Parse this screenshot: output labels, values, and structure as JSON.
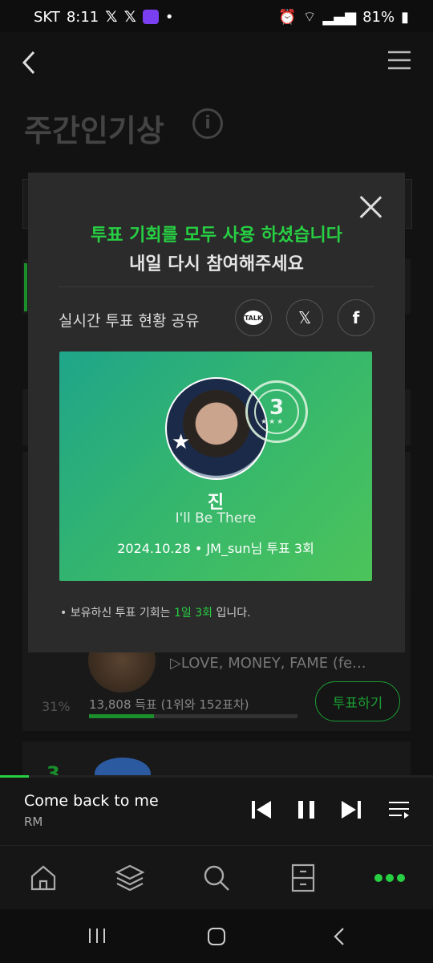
{
  "status_bar": {
    "carrier": "SKT",
    "time": "8:11",
    "battery": "81%"
  },
  "page": {
    "title": "주간인기상"
  },
  "modal": {
    "message_primary": "투표 기회를 모두 사용 하셨습니다",
    "message_secondary": "내일 다시 참여해주세요",
    "share_label": "실시간 투표 현황 공유",
    "share_buttons": [
      "kakaotalk-icon",
      "x-icon",
      "facebook-icon"
    ],
    "talk_label": "TALK",
    "card": {
      "stamp_number": "3",
      "artist": "진",
      "song": "I'll Be There",
      "meta": "2024.10.28  •  JM_sun님 투표 3회"
    },
    "note_prefix": "• 보유하신 투표 기회는 ",
    "note_highlight": "1일 3회",
    "note_suffix": " 입니다."
  },
  "background_list": {
    "item_song": "▷LOVE, MONEY, FAME (fe...",
    "item_percent": "31%",
    "item_votes": "13,808 득표 (1위와 152표차)",
    "item_vote_fraction": 0.31,
    "vote_button": "투표하기",
    "next_rank": "3"
  },
  "mini_player": {
    "title": "Come back to me",
    "artist": "RM"
  },
  "bottom_nav": [
    "home-icon",
    "layers-icon",
    "search-icon",
    "storage-icon",
    "more-icon"
  ],
  "colors": {
    "accent_green": "#27d043",
    "modal_bg": "#2b2b2b"
  }
}
